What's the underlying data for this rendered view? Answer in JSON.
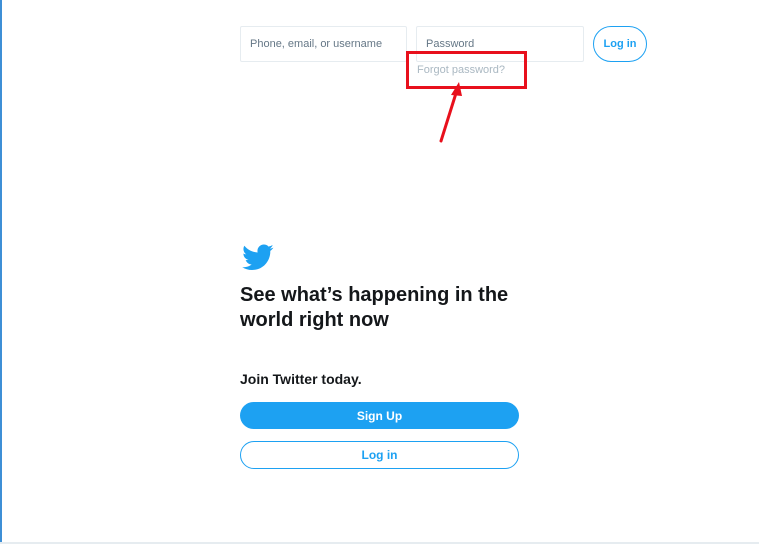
{
  "header": {
    "username_placeholder": "Phone, email, or username",
    "password_placeholder": "Password",
    "login_label": "Log in",
    "forgot_password": "Forgot password?"
  },
  "annotation": {
    "highlight_color": "#e8101c"
  },
  "main": {
    "logo_icon": "twitter-bird-icon",
    "headline": "See what’s happening in the world right now",
    "join_text": "Join Twitter today.",
    "signup_label": "Sign Up",
    "login_label": "Log in"
  },
  "colors": {
    "brand": "#1da1f2",
    "text": "#14171a",
    "muted": "#aab8c2"
  }
}
